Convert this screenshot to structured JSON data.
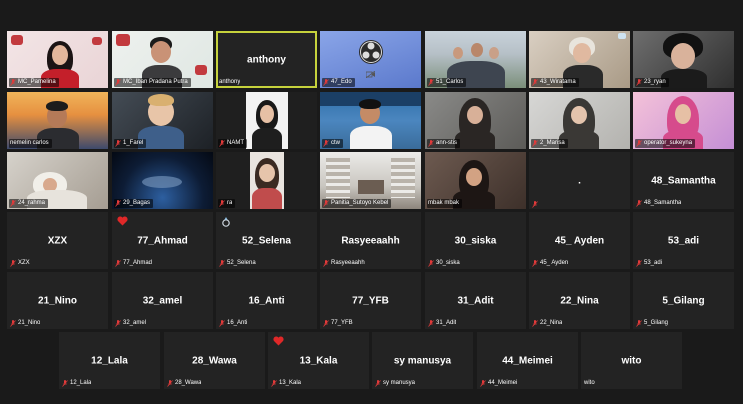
{
  "colors": {
    "background": "#1a1a1a",
    "tile": "#232323",
    "active_border": "#c6d23c",
    "muted_mic": "#e23a3a",
    "heart": "#e02828"
  },
  "participants": [
    {
      "name": "MC_Pamelina",
      "center": "",
      "muted": true
    },
    {
      "name": "MC_Iban Pradana Putra",
      "center": "",
      "muted": true
    },
    {
      "name": "anthony",
      "center": "anthony",
      "muted": false
    },
    {
      "name": "47_Edo",
      "center": "",
      "muted": true
    },
    {
      "name": "51_Carlos",
      "center": "",
      "muted": true
    },
    {
      "name": "43_Wiratama",
      "center": "",
      "muted": true
    },
    {
      "name": "23_ryan",
      "center": "",
      "muted": true
    },
    {
      "name": "nemelin carlos",
      "center": "",
      "muted": false
    },
    {
      "name": "1_Farel",
      "center": "",
      "muted": true
    },
    {
      "name": "NAMT",
      "center": "",
      "muted": true
    },
    {
      "name": "ctw",
      "center": "",
      "muted": true
    },
    {
      "name": "ann-stis",
      "center": "",
      "muted": true
    },
    {
      "name": "2_Marisa",
      "center": "",
      "muted": true
    },
    {
      "name": "operator_sukeyna",
      "center": "",
      "muted": true
    },
    {
      "name": "24_rahma",
      "center": "",
      "muted": true
    },
    {
      "name": "29_Bagas",
      "center": "",
      "muted": true
    },
    {
      "name": "ra",
      "center": "",
      "muted": true
    },
    {
      "name": "Panitia_Sutoyo Kebel",
      "center": "",
      "muted": true
    },
    {
      "name": "mbak mbak",
      "center": "",
      "muted": true
    },
    {
      "name": "",
      "center": ".",
      "muted": true
    },
    {
      "name": "48_Samantha",
      "center": "48_Samantha",
      "muted": true
    },
    {
      "name": "XZX",
      "center": "XZX",
      "muted": true
    },
    {
      "name": "77_Ahmad",
      "center": "77_Ahmad",
      "muted": true
    },
    {
      "name": "52_Selena",
      "center": "52_Selena",
      "muted": true
    },
    {
      "name": "Rasyeeaahh",
      "center": "Rasyeeaahh",
      "muted": true
    },
    {
      "name": "30_siska",
      "center": "30_siska",
      "muted": true
    },
    {
      "name": "45_ Ayden",
      "center": "45_ Ayden",
      "muted": true
    },
    {
      "name": "53_adi",
      "center": "53_adi",
      "muted": true
    },
    {
      "name": "21_Nino",
      "center": "21_Nino",
      "muted": true
    },
    {
      "name": "32_amel",
      "center": "32_amel",
      "muted": true
    },
    {
      "name": "16_Anti",
      "center": "16_Anti",
      "muted": true
    },
    {
      "name": "77_YFB",
      "center": "77_YFB",
      "muted": true
    },
    {
      "name": "31_Adit",
      "center": "31_Adit",
      "muted": true
    },
    {
      "name": "22_Nina",
      "center": "22_Nina",
      "muted": true
    },
    {
      "name": "5_Gilang",
      "center": "5_Gilang",
      "muted": true
    },
    {
      "name": "12_Lala",
      "center": "12_Lala",
      "muted": true
    },
    {
      "name": "28_Wawa",
      "center": "28_Wawa",
      "muted": true
    },
    {
      "name": "13_Kala",
      "center": "13_Kala",
      "muted": true
    },
    {
      "name": "sy manusya",
      "center": "sy manusya",
      "muted": true
    },
    {
      "name": "44_Meimei",
      "center": "44_Meimei",
      "muted": true
    },
    {
      "name": "wito",
      "center": "wito",
      "muted": false
    }
  ]
}
